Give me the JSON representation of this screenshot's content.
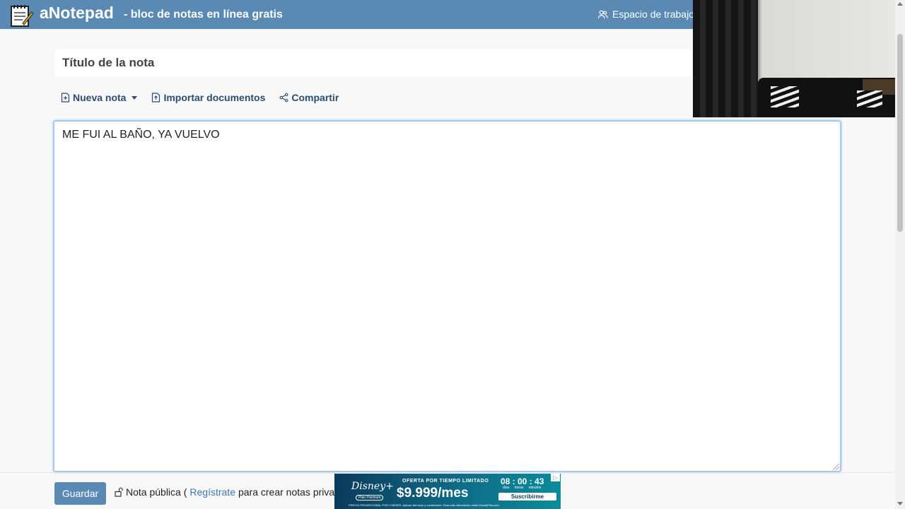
{
  "header": {
    "brand": "aNotepad",
    "tagline": "- bloc de notas en línea gratis",
    "workspace_label": "Espacio de trabajo"
  },
  "note": {
    "title_placeholder": "Título de la nota",
    "content": "ME FUI AL BAÑO, YA VUELVO"
  },
  "toolbar": {
    "new_note": "Nueva nota",
    "import": "Importar documentos",
    "share": "Compartir"
  },
  "footer": {
    "save_label": "Guardar",
    "public_prefix": "Nota pública (",
    "register_link": "Regístrate",
    "public_suffix": " para crear notas privadas)"
  },
  "ad": {
    "brand": "Disney+",
    "plan": "Plan Premium",
    "offer": "OFERTA POR TIEMPO LIMITADO",
    "price": "$9.999/mes",
    "timer": "08 : 00 : 43",
    "timer_units": "días horas minutos",
    "cta": "Suscribirme",
    "fine_print": "PRECIO PROMOCIONAL POR 2 MESES. Aplican términos y condiciones. Para más información visita DisneyPlus.com."
  },
  "colors": {
    "header_bg": "#5a8ab4",
    "toolbar_text": "#2a4d6e",
    "editor_border": "#a8c8ec",
    "link": "#3c78b4"
  },
  "icons": [
    "notepad-logo-icon",
    "users-icon",
    "new-file-icon",
    "import-file-icon",
    "share-icon",
    "unlock-icon"
  ]
}
